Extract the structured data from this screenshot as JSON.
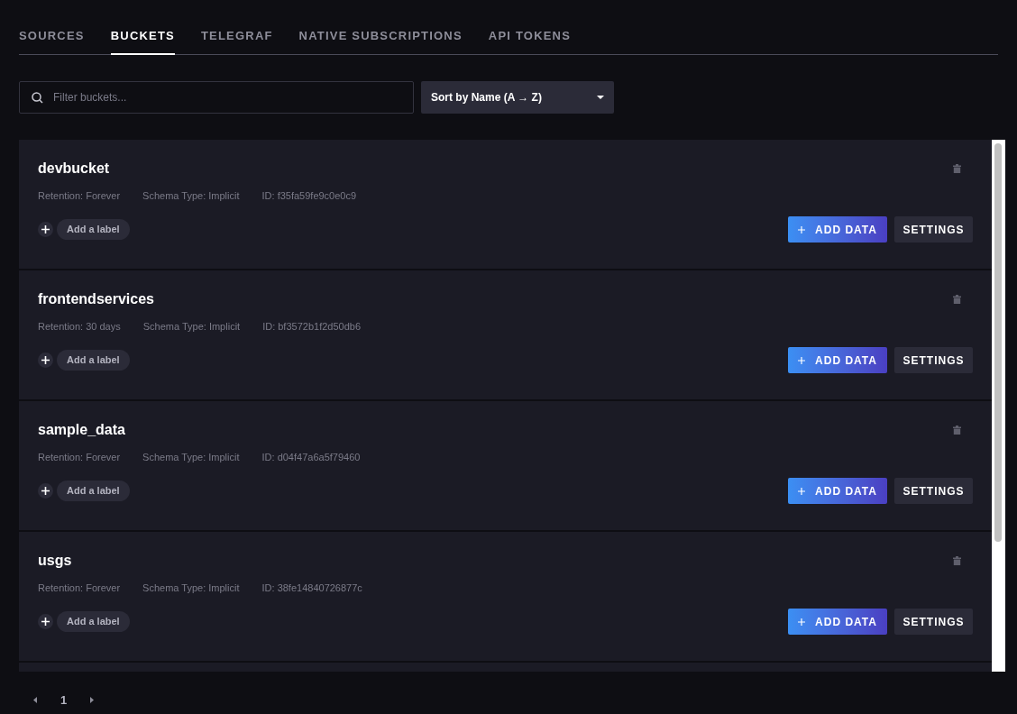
{
  "tabs": [
    {
      "label": "SOURCES",
      "selected": false
    },
    {
      "label": "BUCKETS",
      "selected": true
    },
    {
      "label": "TELEGRAF",
      "selected": false
    },
    {
      "label": "NATIVE SUBSCRIPTIONS",
      "selected": false
    },
    {
      "label": "API TOKENS",
      "selected": false
    }
  ],
  "filter": {
    "placeholder": "Filter buckets..."
  },
  "sort": {
    "value": "Sort by Name (A → Z)"
  },
  "buckets": [
    {
      "name": "devbucket",
      "retention": "Retention: Forever",
      "schema": "Schema Type: Implicit",
      "id": "ID: f35fa59fe9c0e0c9",
      "label_button": "Add a label",
      "add_data": "ADD DATA",
      "settings": "SETTINGS"
    },
    {
      "name": "frontendservices",
      "retention": "Retention: 30 days",
      "schema": "Schema Type: Implicit",
      "id": "ID: bf3572b1f2d50db6",
      "label_button": "Add a label",
      "add_data": "ADD DATA",
      "settings": "SETTINGS"
    },
    {
      "name": "sample_data",
      "retention": "Retention: Forever",
      "schema": "Schema Type: Implicit",
      "id": "ID: d04f47a6a5f79460",
      "label_button": "Add a label",
      "add_data": "ADD DATA",
      "settings": "SETTINGS"
    },
    {
      "name": "usgs",
      "retention": "Retention: Forever",
      "schema": "Schema Type: Implicit",
      "id": "ID: 38fe14840726877c",
      "label_button": "Add a label",
      "add_data": "ADD DATA",
      "settings": "SETTINGS"
    }
  ],
  "pagination": {
    "pages": [
      {
        "label": "1",
        "selected": true
      }
    ]
  }
}
